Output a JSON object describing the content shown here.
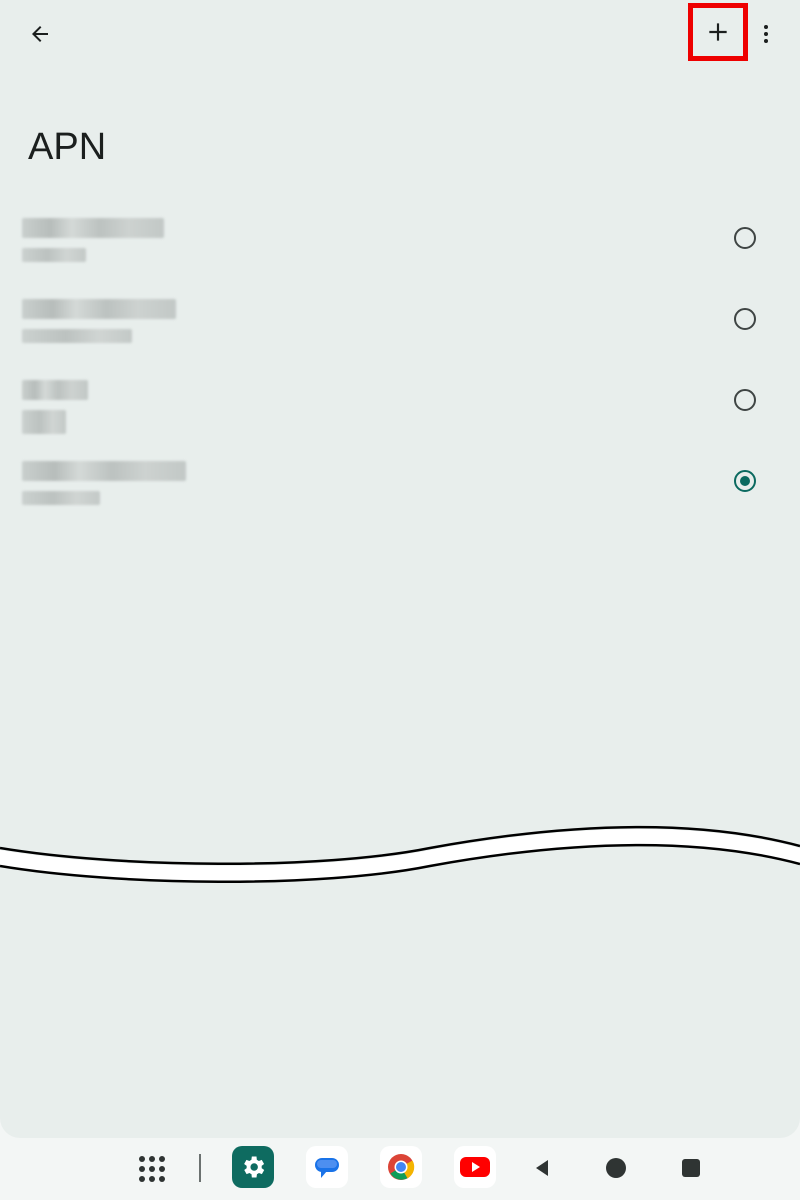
{
  "header": {
    "title": "APN",
    "back_icon": "arrow-back-icon",
    "add_icon": "plus-icon",
    "more_icon": "more-vert-icon"
  },
  "apn_list": [
    {
      "name": "",
      "subtitle": "",
      "selected": false
    },
    {
      "name": "",
      "subtitle": "",
      "selected": false
    },
    {
      "name": "",
      "subtitle": "",
      "selected": false
    },
    {
      "name": "",
      "subtitle": "",
      "selected": true
    }
  ],
  "taskbar": {
    "items": [
      "app-grid-icon",
      "settings-icon",
      "messages-icon",
      "chrome-icon",
      "youtube-icon",
      "back-nav-icon",
      "home-nav-icon",
      "recents-nav-icon"
    ]
  },
  "colors": {
    "background": "#e8eeec",
    "accent": "#0b6a60",
    "highlight": "#ee0000"
  }
}
